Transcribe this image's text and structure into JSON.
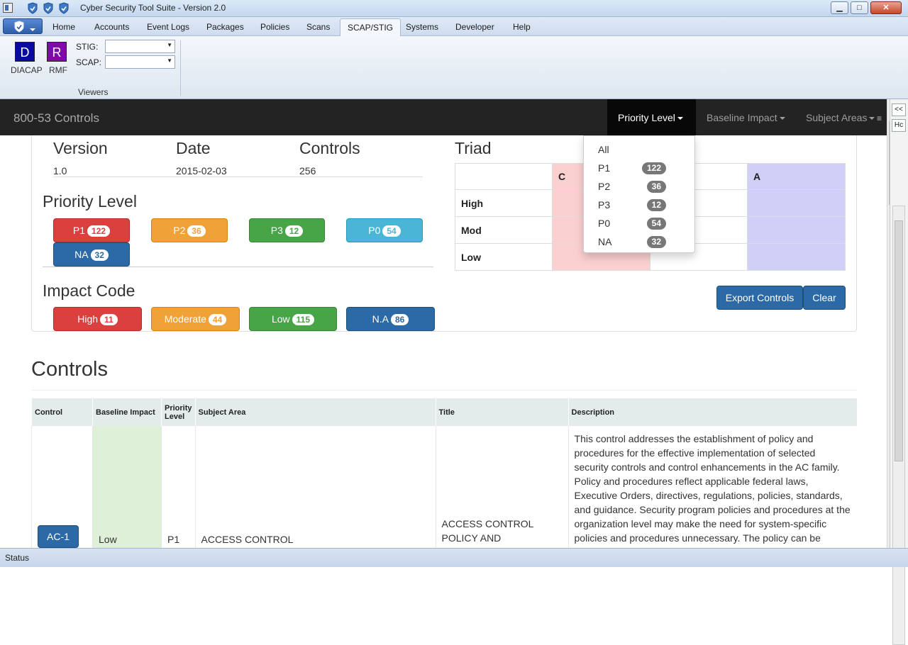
{
  "window": {
    "title": "Cyber Security Tool Suite - Version 2.0",
    "min_glyph": "▁",
    "max_glyph": "□",
    "close_glyph": "✕"
  },
  "menu": {
    "tabs": [
      "Home",
      "Accounts",
      "Event Logs",
      "Packages",
      "Policies",
      "Scans",
      "SCAP/STIG",
      "Systems",
      "Developer",
      "Help"
    ],
    "active_tab": "SCAP/STIG"
  },
  "ribbon": {
    "diacap_letter": "D",
    "diacap_label": "DIACAP",
    "rmf_letter": "R",
    "rmf_label": "RMF",
    "stig_label": "STIG:",
    "scap_label": "SCAP:",
    "stig_value": "",
    "scap_value": "",
    "group_label": "Viewers"
  },
  "navbar": {
    "brand": "800-53 Controls",
    "priority": "Priority Level",
    "baseline": "Baseline Impact",
    "subject": "Subject Areas"
  },
  "sidepanel": {
    "collapse": "<<",
    "tab": "Hc"
  },
  "summary": {
    "version_label": "Version",
    "version": "1.0",
    "date_label": "Date",
    "date": "2015-02-03",
    "controls_label": "Controls",
    "controls": "256"
  },
  "priority_section": {
    "title": "Priority Level",
    "buttons": [
      {
        "label": "P1",
        "count": "122"
      },
      {
        "label": "P2",
        "count": "36"
      },
      {
        "label": "P3",
        "count": "12"
      },
      {
        "label": "P0",
        "count": "54"
      },
      {
        "label": "NA",
        "count": "32"
      }
    ]
  },
  "impact_section": {
    "title": "Impact Code",
    "buttons": [
      {
        "label": "High",
        "count": "11"
      },
      {
        "label": "Moderate",
        "count": "44"
      },
      {
        "label": "Low",
        "count": "115"
      },
      {
        "label": "N.A",
        "count": "86"
      }
    ]
  },
  "triad": {
    "title": "Triad",
    "c_header": "C",
    "a_header": "A",
    "rows": [
      "High",
      "Mod",
      "Low"
    ]
  },
  "actions": {
    "export": "Export Controls",
    "clear": "Clear"
  },
  "dropdown": {
    "items": [
      {
        "label": "All",
        "count": ""
      },
      {
        "label": "P1",
        "count": "122"
      },
      {
        "label": "P2",
        "count": "36"
      },
      {
        "label": "P3",
        "count": "12"
      },
      {
        "label": "P0",
        "count": "54"
      },
      {
        "label": "NA",
        "count": "32"
      }
    ]
  },
  "controls": {
    "title": "Controls",
    "headers": [
      "Control",
      "Baseline Impact",
      "Priority Level",
      "Subject Area",
      "Title",
      "Description"
    ],
    "rows": [
      {
        "control": "AC-1",
        "impact": "Low",
        "priority": "P1",
        "subject": "ACCESS CONTROL",
        "title": "ACCESS CONTROL POLICY AND",
        "description": "This control addresses the establishment of policy and procedures for the effective implementation of selected security controls and control enhancements in the AC family. Policy and procedures reflect applicable federal laws, Executive Orders, directives, regulations, policies, standards, and guidance. Security program policies and procedures at the organization level may make the need for system-specific policies and procedures unnecessary. The policy can be"
      }
    ]
  },
  "status": {
    "text": "Status"
  }
}
